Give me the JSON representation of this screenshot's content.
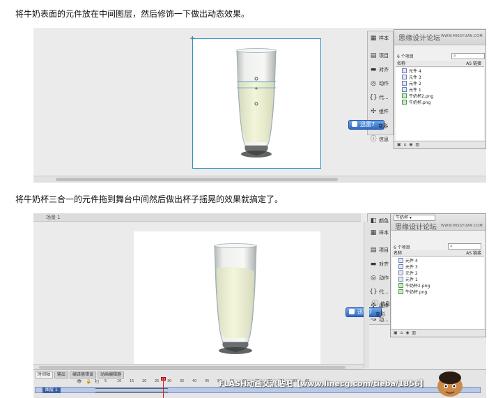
{
  "captions": {
    "top": "将牛奶表面的元件放在中间图层，然后修饰一下做出动态效果。",
    "middle": "将牛奶杯三合一的元件拖到舞台中间然后做出杯子摇晃的效果就搞定了。"
  },
  "panel_top": {
    "side_items": [
      {
        "icon": "swatches-icon",
        "label": "样本"
      },
      {
        "icon": "project-icon",
        "label": "项目"
      },
      {
        "icon": "align-icon",
        "label": "对齐"
      },
      {
        "icon": "actions-icon",
        "label": "动作"
      },
      {
        "icon": "code-icon",
        "label": "代..."
      },
      {
        "icon": "components-icon",
        "label": "组件"
      },
      {
        "icon": "motion-icon",
        "label": "动..."
      },
      {
        "icon": "info-icon",
        "label": "信息"
      },
      {
        "icon": "transform-icon",
        "label": "变形"
      }
    ],
    "library": {
      "title": "思缘设计论坛",
      "watermark": "WWW.MISSYUAN.COM",
      "count": "6 个项目",
      "col_name": "名称",
      "col_link": "AS 链接",
      "items": [
        {
          "label": "元件 4",
          "kind": "symbol"
        },
        {
          "label": "元件 3",
          "kind": "symbol"
        },
        {
          "label": "元件 2",
          "kind": "symbol"
        },
        {
          "label": "元件 1",
          "kind": "symbol"
        },
        {
          "label": "牛奶杯2.png",
          "kind": "bitmap"
        },
        {
          "label": "牛奶杯.png",
          "kind": "bitmap"
        }
      ]
    }
  },
  "panel_bottom": {
    "side_items": [
      {
        "icon": "color-icon",
        "label": "颜色"
      },
      {
        "icon": "swatches-icon",
        "label": "样本"
      },
      {
        "icon": "project-icon",
        "label": "项目"
      },
      {
        "icon": "align-icon",
        "label": "对齐"
      },
      {
        "icon": "actions-icon",
        "label": "动作"
      },
      {
        "icon": "code-icon",
        "label": "代..."
      },
      {
        "icon": "components-icon",
        "label": "组件"
      },
      {
        "icon": "motion-icon",
        "label": "动..."
      },
      {
        "icon": "info-icon",
        "label": "信息"
      },
      {
        "icon": "transform-icon",
        "label": "变形"
      }
    ],
    "library": {
      "dropdown": "牛奶杯",
      "title": "思缘设计论坛",
      "watermark": "WWW.MISSYUAN.COM",
      "count": "6 个项目",
      "col_name": "名称",
      "col_link": "AS 链接",
      "items": [
        {
          "label": "元件 4",
          "kind": "symbol"
        },
        {
          "label": "元件 3",
          "kind": "symbol"
        },
        {
          "label": "元件 2",
          "kind": "symbol"
        },
        {
          "label": "元件 1",
          "kind": "symbol"
        },
        {
          "label": "牛奶杯2.png",
          "kind": "bitmap"
        },
        {
          "label": "牛奶杯.png",
          "kind": "bitmap"
        }
      ]
    }
  },
  "xunlei_badge": "迅雷7",
  "stage_bottom": {
    "breadcrumb": "场景 1"
  },
  "timeline": {
    "tabs": [
      "时间轴",
      "输出",
      "编译器错误",
      "动画编辑器"
    ],
    "layer_name": "图层 1",
    "ruler": [
      "1",
      "5",
      "10",
      "15",
      "20",
      "25",
      "30",
      "35",
      "40",
      "45",
      "50",
      "55",
      "60",
      "65",
      "70",
      "75",
      "80",
      "85"
    ]
  },
  "footer_watermark": "FLASH动画交流贴吧【www.linecg.com/tieba/1856】",
  "colors": {
    "stage_border": "#2f93c2",
    "badge": "#2d6cc3",
    "milk": "#eef2cf"
  }
}
